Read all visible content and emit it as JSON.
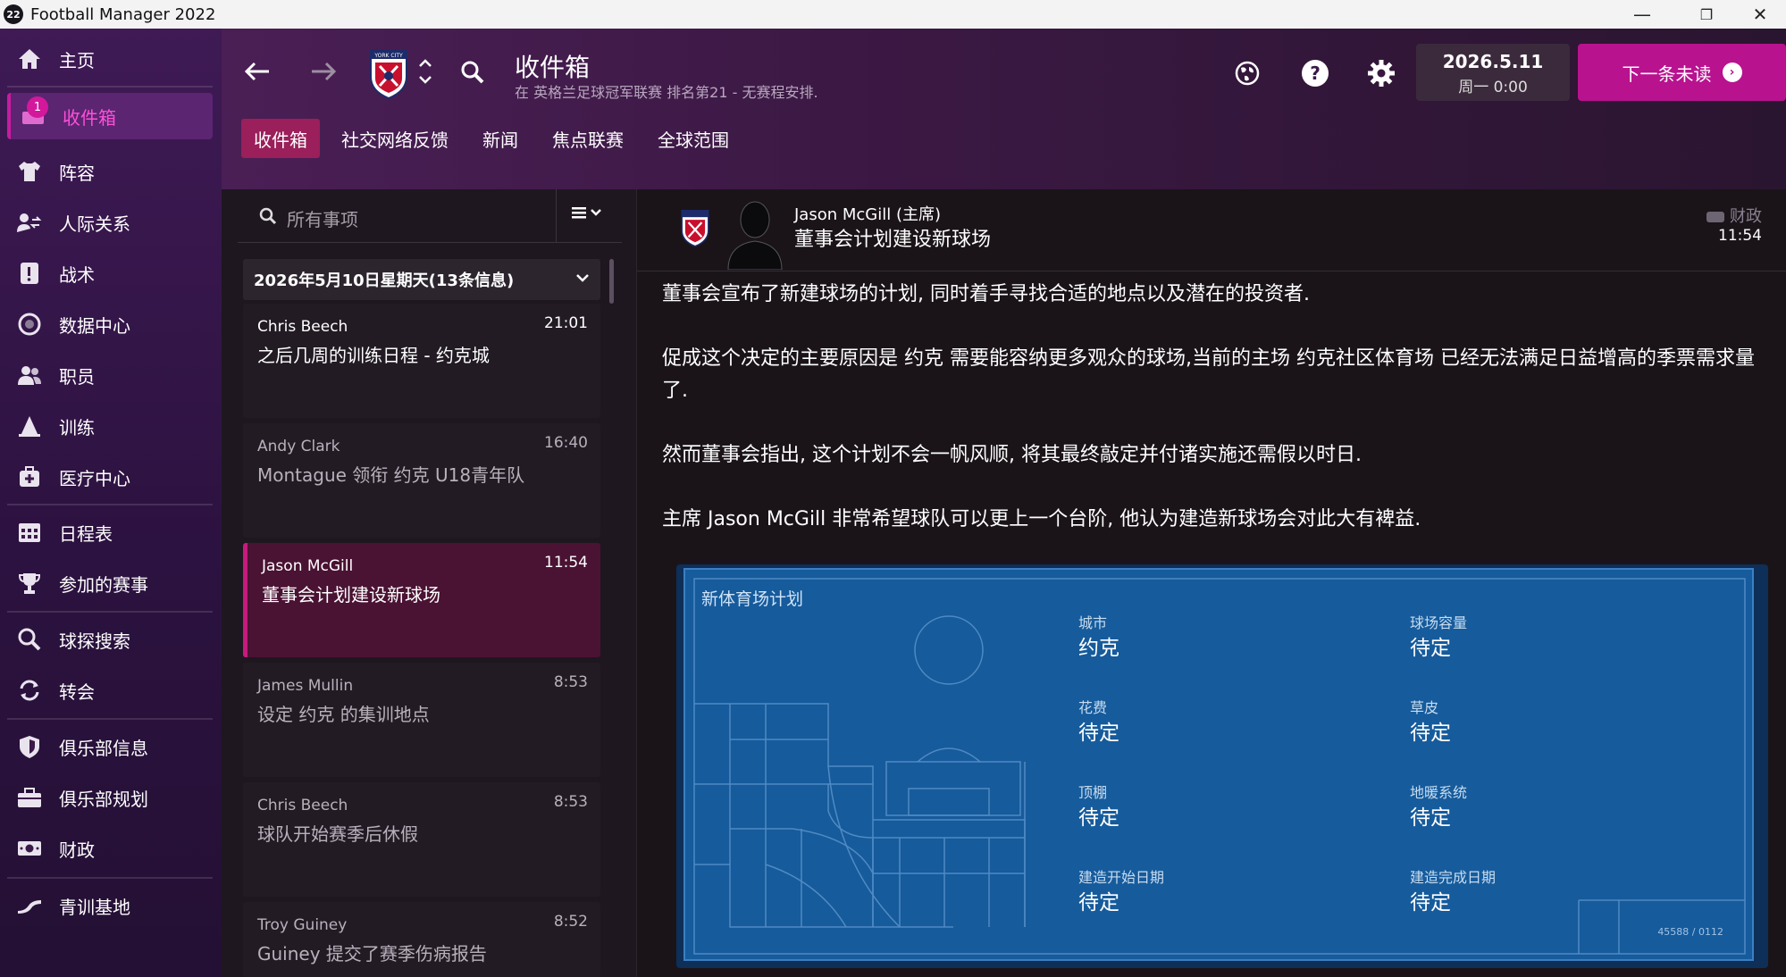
{
  "window": {
    "app_icon_text": "22",
    "title": "Football Manager 2022",
    "controls": {
      "minimize": "—",
      "maximize": "❐",
      "close": "✕"
    }
  },
  "sidebar": {
    "items": [
      {
        "label": "主页",
        "icon": "home-icon"
      },
      {
        "label": "收件箱",
        "icon": "inbox-icon",
        "badge": "1"
      },
      {
        "label": "阵容",
        "icon": "shirt-icon"
      },
      {
        "label": "人际关系",
        "icon": "relationships-icon"
      },
      {
        "label": "战术",
        "icon": "tactics-icon"
      },
      {
        "label": "数据中心",
        "icon": "data-hub-icon"
      },
      {
        "label": "职员",
        "icon": "staff-icon"
      },
      {
        "label": "训练",
        "icon": "training-icon"
      },
      {
        "label": "医疗中心",
        "icon": "medical-icon"
      },
      {
        "label": "日程表",
        "icon": "calendar-icon"
      },
      {
        "label": "参加的赛事",
        "icon": "trophy-icon"
      },
      {
        "label": "球探搜索",
        "icon": "scouting-icon"
      },
      {
        "label": "转会",
        "icon": "transfers-icon"
      },
      {
        "label": "俱乐部信息",
        "icon": "club-shield-icon"
      },
      {
        "label": "俱乐部规划",
        "icon": "club-vision-icon"
      },
      {
        "label": "财政",
        "icon": "finances-icon"
      },
      {
        "label": "青训基地",
        "icon": "youth-icon"
      }
    ]
  },
  "header": {
    "title": "收件箱",
    "subtitle": "在 英格兰足球冠军联赛 排名第21 - 无赛程安排.",
    "crest_text": "YORK CITY",
    "date": "2026.5.11",
    "day_time": "周一 0:00",
    "next_button": "下一条未读",
    "tabs": [
      "收件箱",
      "社交网络反馈",
      "新闻",
      "焦点联赛",
      "全球范围"
    ]
  },
  "list": {
    "search_placeholder": "所有事项",
    "group_header": "2026年5月10日星期天(13条信息)",
    "messages": [
      {
        "sender": "Chris Beech",
        "time": "21:01",
        "subject": "之后几周的训练日程 - 约克城"
      },
      {
        "sender": "Andy Clark",
        "time": "16:40",
        "subject": "Montague 领衔 约克 U18青年队"
      },
      {
        "sender": "Jason McGill",
        "time": "11:54",
        "subject": "董事会计划建设新球场"
      },
      {
        "sender": "James Mullin",
        "time": "8:53",
        "subject": "设定 约克 的集训地点"
      },
      {
        "sender": "Chris Beech",
        "time": "8:53",
        "subject": "球队开始赛季后休假"
      },
      {
        "sender": "Troy Guiney",
        "time": "8:52",
        "subject": "Guiney 提交了赛季伤病报告"
      }
    ]
  },
  "reader": {
    "from": "Jason McGill (主席)",
    "subject": "董事会计划建设新球场",
    "category": "财政",
    "time": "11:54",
    "paragraphs": [
      "董事会宣布了新建球场的计划, 同时着手寻找合适的地点以及潜在的投资者.",
      "促成这个决定的主要原因是 约克 需要能容纳更多观众的球场,当前的主场 约克社区体育场 已经无法满足日益增高的季票需求量了.",
      "然而董事会指出, 这个计划不会一帆风顺, 将其最终敲定并付诸实施还需假以时日.",
      "主席 Jason McGill 非常希望球队可以更上一个台阶, 他认为建造新球场会对此大有裨益."
    ],
    "plan": {
      "title": "新体育场计划",
      "fields": [
        {
          "label": "城市",
          "value": "约克"
        },
        {
          "label": "球场容量",
          "value": "待定"
        },
        {
          "label": "花费",
          "value": "待定"
        },
        {
          "label": "草皮",
          "value": "待定"
        },
        {
          "label": "顶棚",
          "value": "待定"
        },
        {
          "label": "地暖系统",
          "value": "待定"
        },
        {
          "label": "建造开始日期",
          "value": "待定"
        },
        {
          "label": "建造完成日期",
          "value": "待定"
        }
      ],
      "code": "45588 / 0112"
    }
  },
  "colors": {
    "accent": "#b8128f",
    "active_tab": "#9a1f5b",
    "plan_blue": "#165b9c"
  }
}
